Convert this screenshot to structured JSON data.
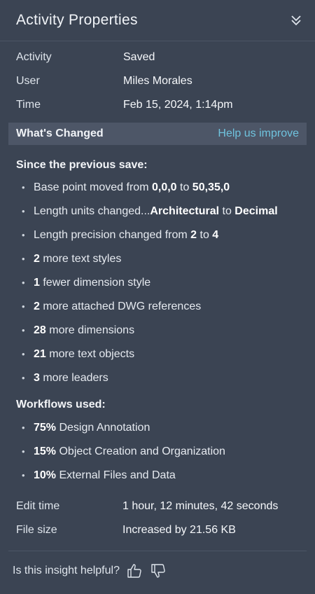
{
  "panel": {
    "title": "Activity Properties",
    "collapse_icon": "double-chevron-down-icon"
  },
  "properties": [
    {
      "label": "Activity",
      "value": "Saved"
    },
    {
      "label": "User",
      "value": "Miles Morales"
    },
    {
      "label": "Time",
      "value": "Feb 15, 2024, 1:14pm"
    }
  ],
  "whats_changed": {
    "title": "What's Changed",
    "help_link": "Help us improve"
  },
  "since": {
    "heading": "Since the previous save:",
    "items": [
      {
        "parts": [
          {
            "t": "Base point moved from "
          },
          {
            "t": "0,0,0",
            "b": true
          },
          {
            "t": " to "
          },
          {
            "t": "50,35,0",
            "b": true
          }
        ]
      },
      {
        "parts": [
          {
            "t": "Length units changed..."
          },
          {
            "t": "Architectural",
            "b": true
          },
          {
            "t": " to "
          },
          {
            "t": "Decimal",
            "b": true
          }
        ]
      },
      {
        "parts": [
          {
            "t": "Length precision changed from "
          },
          {
            "t": "2",
            "b": true
          },
          {
            "t": " to "
          },
          {
            "t": "4",
            "b": true
          }
        ]
      },
      {
        "parts": [
          {
            "t": "2",
            "b": true
          },
          {
            "t": " more text styles"
          }
        ]
      },
      {
        "parts": [
          {
            "t": "1",
            "b": true
          },
          {
            "t": " fewer dimension style"
          }
        ]
      },
      {
        "parts": [
          {
            "t": "2",
            "b": true
          },
          {
            "t": " more attached DWG references"
          }
        ]
      },
      {
        "parts": [
          {
            "t": "28",
            "b": true
          },
          {
            "t": " more dimensions"
          }
        ]
      },
      {
        "parts": [
          {
            "t": "21",
            "b": true
          },
          {
            "t": " more text objects"
          }
        ]
      },
      {
        "parts": [
          {
            "t": "3",
            "b": true
          },
          {
            "t": " more leaders"
          }
        ]
      }
    ]
  },
  "workflows": {
    "heading": "Workflows used:",
    "items": [
      {
        "parts": [
          {
            "t": "75%",
            "b": true
          },
          {
            "t": " Design Annotation"
          }
        ]
      },
      {
        "parts": [
          {
            "t": "15%",
            "b": true
          },
          {
            "t": " Object Creation and Organization"
          }
        ]
      },
      {
        "parts": [
          {
            "t": "10%",
            "b": true
          },
          {
            "t": " External Files and Data"
          }
        ]
      }
    ]
  },
  "stats": [
    {
      "label": "Edit time",
      "value": "1 hour, 12 minutes, 42 seconds"
    },
    {
      "label": "File size",
      "value": "Increased by 21.56 KB"
    }
  ],
  "feedback": {
    "question": "Is this insight helpful?",
    "thumbs_up_icon": "thumbs-up-icon",
    "thumbs_down_icon": "thumbs-down-icon"
  },
  "colors": {
    "background": "#3b4453",
    "bar": "#4d5667",
    "link": "#6fc3de",
    "text": "#e9edf2"
  }
}
